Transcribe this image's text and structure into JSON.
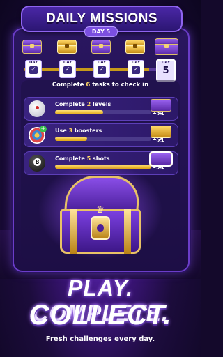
{
  "header": {
    "title": "DAILY MISSIONS",
    "day_badge": "DAY 5"
  },
  "calendar": {
    "day_label": "DAY",
    "checkmark": "✓",
    "current_day": "5",
    "days": [
      {
        "state": "claimed",
        "chest": "purple"
      },
      {
        "state": "claimed",
        "chest": "gold"
      },
      {
        "state": "claimed",
        "chest": "purple"
      },
      {
        "state": "claimed",
        "chest": "gold"
      },
      {
        "state": "current",
        "chest": "purple"
      }
    ]
  },
  "tasks_header": {
    "prefix": "Complete ",
    "count": "6",
    "suffix": " tasks to check in"
  },
  "tasks": [
    {
      "pre": "Complete ",
      "num": "2",
      "post": " levels",
      "progress": "1/2",
      "fill_fraction": 0.5,
      "icon": "cue-ball-icon",
      "reward": "x1",
      "reward_type": "purple-chest"
    },
    {
      "pre": "Use ",
      "num": "3",
      "post": " boosters",
      "progress": "1/3",
      "fill_fraction": 0.33,
      "icon": "target-booster-icon",
      "reward": "x1",
      "reward_type": "gold-chest"
    },
    {
      "pre": "Complete ",
      "num": "5",
      "post": " shots",
      "progress": "5/5",
      "fill_fraction": 1.0,
      "icon": "eight-ball-icon",
      "reward": "x1",
      "reward_type": "purple-chest"
    }
  ],
  "tagline": {
    "line1": "PLAY. COMPLETE.",
    "line2": "COLLECT.",
    "sub": "Fresh challenges every day."
  },
  "colors": {
    "accent_gold": "#ffd866",
    "panel_purple": "#2a1660",
    "highlight": "#8f64f0"
  }
}
